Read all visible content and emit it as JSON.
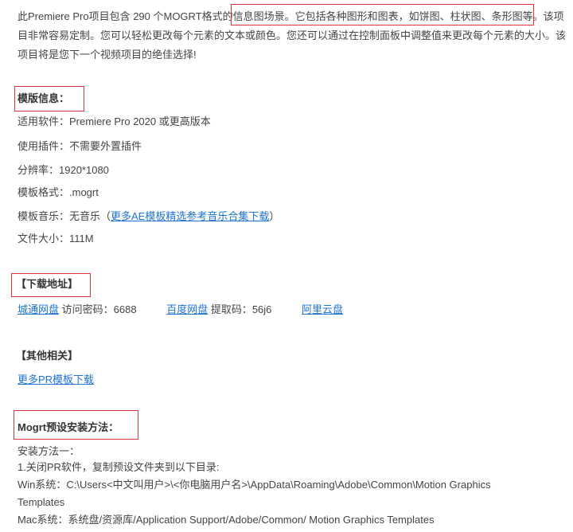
{
  "intro": {
    "line1_pre": "此Premiere Pro项目包含 290 个MOGRT格式的",
    "line1_hl": "信息图场景。它包括各种图形和图表，如饼图、柱状图、条形图等。",
    "line1_post": "该项",
    "line2": "目非常容易定制。您可以轻松更改每个元素的文本或颜色。您还可以通过在控制面板中调整值来更改每个元素的大小。该",
    "line3": "项目将是您下一个视频项目的绝佳选择!"
  },
  "info": {
    "heading": "模版信息：",
    "software": "适用软件：Premiere Pro 2020 或更高版本",
    "plugin": "使用插件：不需要外置插件",
    "resolution": "分辨率：1920*1080",
    "format": "模板格式：.mogrt",
    "music_label": "模板音乐：无音乐（",
    "music_link": "更多AE模板精选参考音乐合集下载",
    "music_close": "）",
    "size": "文件大小：111M"
  },
  "download": {
    "heading": "【下载地址】",
    "links": [
      {
        "label": "城通网盘",
        "code": "访问密码：6688"
      },
      {
        "label": "百度网盘",
        "code": "提取码：56j6"
      },
      {
        "label": "阿里云盘",
        "code": ""
      }
    ]
  },
  "related": {
    "heading": "【其他相关】",
    "link": "更多PR模板下载"
  },
  "install": {
    "heading": "Mogrt预设安装方法：",
    "method": "安装方法一：",
    "step1": "1.关闭PR软件，复制预设文件夹到以下目录:",
    "win": "Win系统：C:\\Users<中文叫用户>\\<你电脑用户名>\\AppData\\Roaming\\Adobe\\Common\\Motion Graphics",
    "win2": "Templates",
    "mac": "Mac系统：系统盘/资源库/Application Support/Adobe/Common/ Motion Graphics Templates"
  }
}
